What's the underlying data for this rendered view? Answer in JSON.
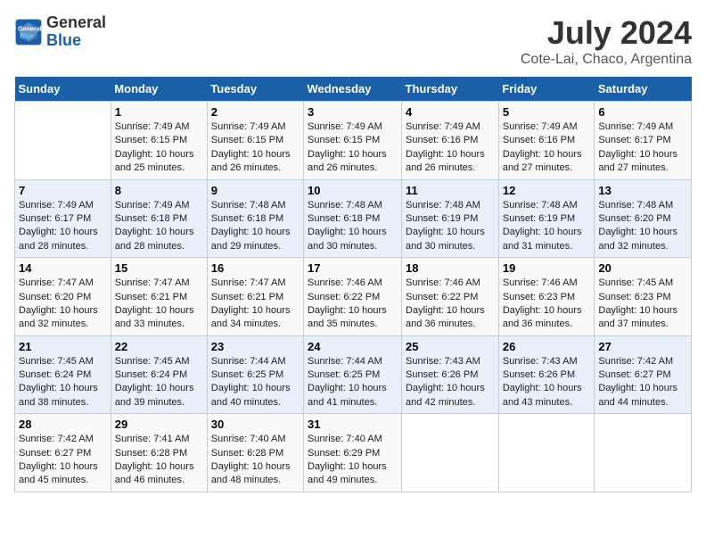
{
  "header": {
    "logo_line1": "General",
    "logo_line2": "Blue",
    "title": "July 2024",
    "subtitle": "Cote-Lai, Chaco, Argentina"
  },
  "calendar": {
    "days_of_week": [
      "Sunday",
      "Monday",
      "Tuesday",
      "Wednesday",
      "Thursday",
      "Friday",
      "Saturday"
    ],
    "weeks": [
      [
        {
          "day": "",
          "info": ""
        },
        {
          "day": "1",
          "info": "Sunrise: 7:49 AM\nSunset: 6:15 PM\nDaylight: 10 hours\nand 25 minutes."
        },
        {
          "day": "2",
          "info": "Sunrise: 7:49 AM\nSunset: 6:15 PM\nDaylight: 10 hours\nand 26 minutes."
        },
        {
          "day": "3",
          "info": "Sunrise: 7:49 AM\nSunset: 6:15 PM\nDaylight: 10 hours\nand 26 minutes."
        },
        {
          "day": "4",
          "info": "Sunrise: 7:49 AM\nSunset: 6:16 PM\nDaylight: 10 hours\nand 26 minutes."
        },
        {
          "day": "5",
          "info": "Sunrise: 7:49 AM\nSunset: 6:16 PM\nDaylight: 10 hours\nand 27 minutes."
        },
        {
          "day": "6",
          "info": "Sunrise: 7:49 AM\nSunset: 6:17 PM\nDaylight: 10 hours\nand 27 minutes."
        }
      ],
      [
        {
          "day": "7",
          "info": "Sunrise: 7:49 AM\nSunset: 6:17 PM\nDaylight: 10 hours\nand 28 minutes."
        },
        {
          "day": "8",
          "info": "Sunrise: 7:49 AM\nSunset: 6:18 PM\nDaylight: 10 hours\nand 28 minutes."
        },
        {
          "day": "9",
          "info": "Sunrise: 7:48 AM\nSunset: 6:18 PM\nDaylight: 10 hours\nand 29 minutes."
        },
        {
          "day": "10",
          "info": "Sunrise: 7:48 AM\nSunset: 6:18 PM\nDaylight: 10 hours\nand 30 minutes."
        },
        {
          "day": "11",
          "info": "Sunrise: 7:48 AM\nSunset: 6:19 PM\nDaylight: 10 hours\nand 30 minutes."
        },
        {
          "day": "12",
          "info": "Sunrise: 7:48 AM\nSunset: 6:19 PM\nDaylight: 10 hours\nand 31 minutes."
        },
        {
          "day": "13",
          "info": "Sunrise: 7:48 AM\nSunset: 6:20 PM\nDaylight: 10 hours\nand 32 minutes."
        }
      ],
      [
        {
          "day": "14",
          "info": "Sunrise: 7:47 AM\nSunset: 6:20 PM\nDaylight: 10 hours\nand 32 minutes."
        },
        {
          "day": "15",
          "info": "Sunrise: 7:47 AM\nSunset: 6:21 PM\nDaylight: 10 hours\nand 33 minutes."
        },
        {
          "day": "16",
          "info": "Sunrise: 7:47 AM\nSunset: 6:21 PM\nDaylight: 10 hours\nand 34 minutes."
        },
        {
          "day": "17",
          "info": "Sunrise: 7:46 AM\nSunset: 6:22 PM\nDaylight: 10 hours\nand 35 minutes."
        },
        {
          "day": "18",
          "info": "Sunrise: 7:46 AM\nSunset: 6:22 PM\nDaylight: 10 hours\nand 36 minutes."
        },
        {
          "day": "19",
          "info": "Sunrise: 7:46 AM\nSunset: 6:23 PM\nDaylight: 10 hours\nand 36 minutes."
        },
        {
          "day": "20",
          "info": "Sunrise: 7:45 AM\nSunset: 6:23 PM\nDaylight: 10 hours\nand 37 minutes."
        }
      ],
      [
        {
          "day": "21",
          "info": "Sunrise: 7:45 AM\nSunset: 6:24 PM\nDaylight: 10 hours\nand 38 minutes."
        },
        {
          "day": "22",
          "info": "Sunrise: 7:45 AM\nSunset: 6:24 PM\nDaylight: 10 hours\nand 39 minutes."
        },
        {
          "day": "23",
          "info": "Sunrise: 7:44 AM\nSunset: 6:25 PM\nDaylight: 10 hours\nand 40 minutes."
        },
        {
          "day": "24",
          "info": "Sunrise: 7:44 AM\nSunset: 6:25 PM\nDaylight: 10 hours\nand 41 minutes."
        },
        {
          "day": "25",
          "info": "Sunrise: 7:43 AM\nSunset: 6:26 PM\nDaylight: 10 hours\nand 42 minutes."
        },
        {
          "day": "26",
          "info": "Sunrise: 7:43 AM\nSunset: 6:26 PM\nDaylight: 10 hours\nand 43 minutes."
        },
        {
          "day": "27",
          "info": "Sunrise: 7:42 AM\nSunset: 6:27 PM\nDaylight: 10 hours\nand 44 minutes."
        }
      ],
      [
        {
          "day": "28",
          "info": "Sunrise: 7:42 AM\nSunset: 6:27 PM\nDaylight: 10 hours\nand 45 minutes."
        },
        {
          "day": "29",
          "info": "Sunrise: 7:41 AM\nSunset: 6:28 PM\nDaylight: 10 hours\nand 46 minutes."
        },
        {
          "day": "30",
          "info": "Sunrise: 7:40 AM\nSunset: 6:28 PM\nDaylight: 10 hours\nand 48 minutes."
        },
        {
          "day": "31",
          "info": "Sunrise: 7:40 AM\nSunset: 6:29 PM\nDaylight: 10 hours\nand 49 minutes."
        },
        {
          "day": "",
          "info": ""
        },
        {
          "day": "",
          "info": ""
        },
        {
          "day": "",
          "info": ""
        }
      ]
    ]
  }
}
